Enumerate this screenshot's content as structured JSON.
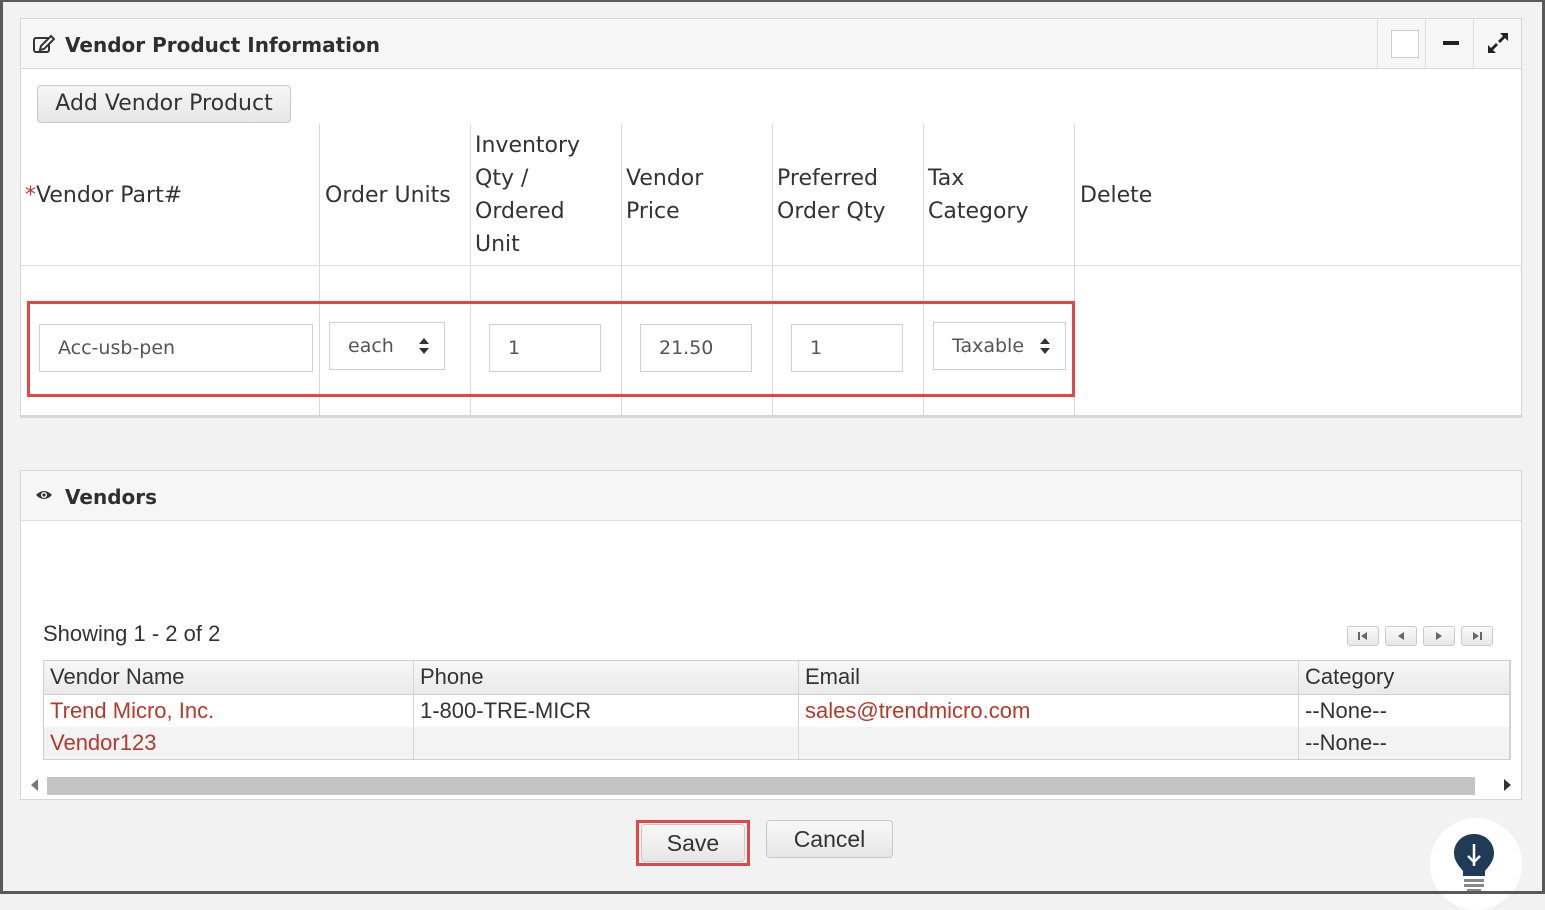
{
  "panel_vendor_product": {
    "title": "Vendor Product Information",
    "add_button": "Add Vendor Product",
    "columns": {
      "req_mark": "*",
      "vendor_part": "Vendor Part#",
      "order_units": "Order Units",
      "inventory_qty_1": "Inventory",
      "inventory_qty_2": "Qty /",
      "inventory_qty_3": "Ordered",
      "inventory_qty_4": "Unit",
      "vendor_price_1": "Vendor",
      "vendor_price_2": "Price",
      "preferred_qty_1": "Preferred",
      "preferred_qty_2": "Order Qty",
      "tax_category_1": "Tax",
      "tax_category_2": "Category",
      "delete": "Delete"
    },
    "row": {
      "vendor_part": "Acc-usb-pen",
      "order_units": "each",
      "inventory_qty": "1",
      "vendor_price": "21.50",
      "preferred_qty": "1",
      "tax_category": "Taxable"
    }
  },
  "panel_vendors": {
    "title": "Vendors",
    "showing": "Showing 1 - 2 of 2",
    "columns": [
      "Vendor Name",
      "Phone",
      "Email",
      "Category"
    ],
    "rows": [
      {
        "name": "Trend Micro, Inc.",
        "phone": "1-800-TRE-MICR",
        "email": "sales@trendmicro.com",
        "category": "--None--"
      },
      {
        "name": "Vendor123",
        "phone": "",
        "email": "",
        "category": "--None--"
      }
    ]
  },
  "actions": {
    "save": "Save",
    "cancel": "Cancel"
  },
  "colors": {
    "highlight": "#e04848",
    "link": "#b23a2a",
    "bulb": "#1f3b57"
  }
}
